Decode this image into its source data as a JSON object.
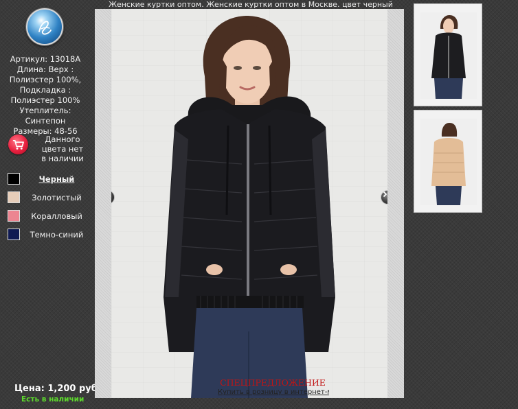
{
  "page_title": "Женские куртки оптом. Женские куртки оптом в Москве. цвет черный",
  "product": {
    "info_lines": [
      "Артикул: 13018A",
      "Длина: Верх :",
      "Полиэстер 100%,",
      "Подкладка :",
      "Полиэстер 100%",
      "Утеплитель:",
      "Синтепон",
      "Размеры: 48-56"
    ],
    "stock_note_lines": [
      "Данного",
      "цвета нет",
      "в наличии"
    ],
    "price": "Цена: 1,200 руб.",
    "availability": "Есть в наличии"
  },
  "colors": [
    {
      "label": "Черный",
      "swatch": "#000000",
      "selected": true
    },
    {
      "label": "Золотистый",
      "swatch": "#e6cdb9",
      "selected": false
    },
    {
      "label": "Коралловый",
      "swatch": "#ec8591",
      "selected": false
    },
    {
      "label": "Темно-синий",
      "swatch": "#101a52",
      "selected": false
    }
  ],
  "main_image": {
    "special_label": "СПЕЦПРЕДЛОЖЕНИЕ",
    "bottom_link": "Купить в розницу в интернет-магазине"
  },
  "icons": {
    "logo": "logo-emblem-icon",
    "cart": "cart-icon",
    "prev": "chevron-left-icon",
    "next": "chevron-right-icon"
  },
  "thumbnails": [
    {
      "name": "black-jacket",
      "jacket_color": "#1d1d20"
    },
    {
      "name": "beige-jacket",
      "jacket_color": "#e3bd97"
    }
  ]
}
